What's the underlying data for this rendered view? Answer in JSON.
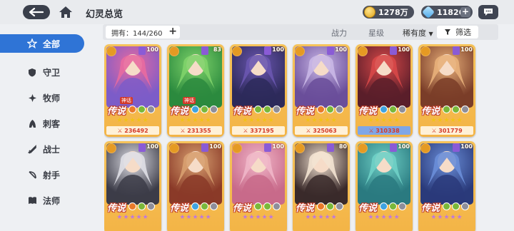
{
  "header": {
    "title": "幻灵总览",
    "gold": "1278万",
    "gems": "11826"
  },
  "sidebar": {
    "items": [
      {
        "label": "全部",
        "icon": "all-star-icon",
        "active": true
      },
      {
        "label": "守卫",
        "icon": "shield-icon",
        "active": false
      },
      {
        "label": "牧师",
        "icon": "priest-icon",
        "active": false
      },
      {
        "label": "刺客",
        "icon": "assassin-icon",
        "active": false
      },
      {
        "label": "战士",
        "icon": "sword-icon",
        "active": false
      },
      {
        "label": "射手",
        "icon": "bow-icon",
        "active": false
      },
      {
        "label": "法师",
        "icon": "book-icon",
        "active": false
      }
    ]
  },
  "filter": {
    "owned": "拥有：144/260",
    "power": "战力",
    "star": "星级",
    "rarity": "稀有度",
    "screen": "筛选"
  },
  "cards": [
    {
      "rank": "传说",
      "level": "100",
      "power": "236492",
      "myth": "神话",
      "stars": "★★★★★",
      "colors": [
        "#e86aa0",
        "#7c5cc8"
      ]
    },
    {
      "rank": "传说",
      "level": "83",
      "power": "231355",
      "myth": "神话",
      "stars": "★★★★★",
      "colors": [
        "#7fd36a",
        "#2b8a3e"
      ]
    },
    {
      "rank": "传说",
      "level": "100",
      "power": "337195",
      "myth": "",
      "stars": "★★★★★",
      "colors": [
        "#6a56b0",
        "#2d2a5a"
      ]
    },
    {
      "rank": "传说",
      "level": "100",
      "power": "325063",
      "myth": "",
      "stars": "★★★★★",
      "colors": [
        "#c9b7e6",
        "#6a4e9a"
      ]
    },
    {
      "rank": "传说",
      "level": "100",
      "power": "310338",
      "myth": "",
      "stars": "★★★★★",
      "colors": [
        "#d84848",
        "#5a1e2a"
      ]
    },
    {
      "rank": "传说",
      "level": "100",
      "power": "301779",
      "myth": "",
      "stars": "★★★★★",
      "colors": [
        "#e8b07a",
        "#7a3d28"
      ]
    },
    {
      "rank": "传说",
      "level": "100",
      "power": "",
      "myth": "",
      "stars": "★★★★★",
      "colors": [
        "#dfdfe6",
        "#3c3c48"
      ]
    },
    {
      "rank": "传说",
      "level": "100",
      "power": "",
      "myth": "",
      "stars": "★★★★★",
      "colors": [
        "#d8a070",
        "#8a3a28"
      ]
    },
    {
      "rank": "传说",
      "level": "100",
      "power": "",
      "myth": "",
      "stars": "★★★★★",
      "colors": [
        "#f0b6c8",
        "#c86a8a"
      ]
    },
    {
      "rank": "传说",
      "level": "80",
      "power": "",
      "myth": "",
      "stars": "★★★★★",
      "colors": [
        "#f3e3d2",
        "#3a2a2a"
      ]
    },
    {
      "rank": "传说",
      "level": "100",
      "power": "",
      "myth": "",
      "stars": "★★★★★",
      "colors": [
        "#6fd0c6",
        "#2a7a80"
      ]
    },
    {
      "rank": "传说",
      "level": "100",
      "power": "",
      "myth": "",
      "stars": "★★★★★",
      "colors": [
        "#6a8ed8",
        "#2a3a7a"
      ]
    }
  ]
}
